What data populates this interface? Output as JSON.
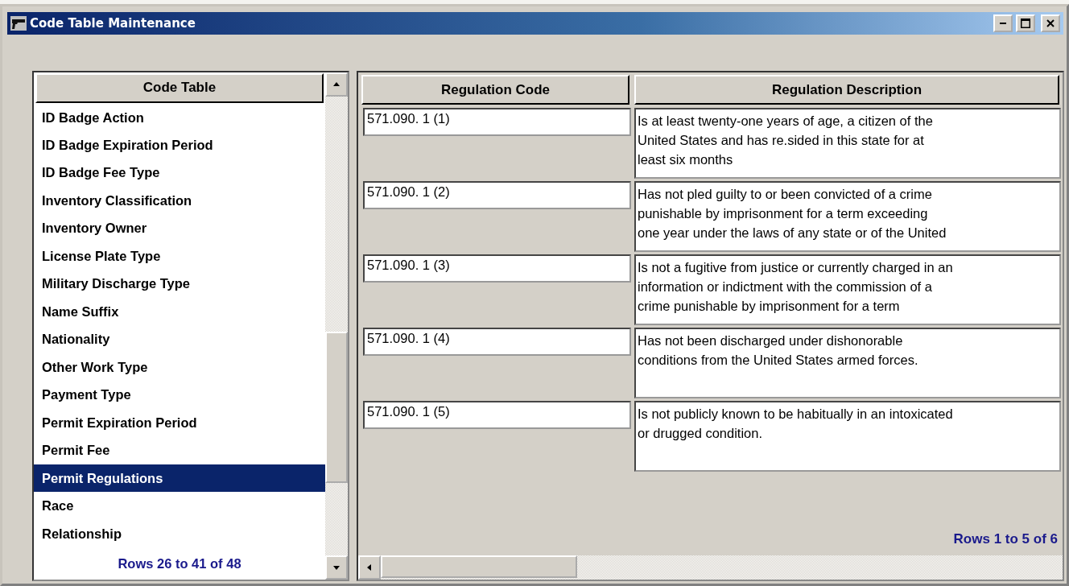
{
  "window": {
    "title": "Code Table Maintenance"
  },
  "code_table": {
    "header": "Code Table",
    "items": [
      {
        "label": "ID Badge Action",
        "selected": false
      },
      {
        "label": "ID Badge Expiration Period",
        "selected": false
      },
      {
        "label": "ID Badge Fee Type",
        "selected": false
      },
      {
        "label": "Inventory Classification",
        "selected": false
      },
      {
        "label": "Inventory Owner",
        "selected": false
      },
      {
        "label": "License Plate Type",
        "selected": false
      },
      {
        "label": "Military Discharge Type",
        "selected": false
      },
      {
        "label": "Name Suffix",
        "selected": false
      },
      {
        "label": "Nationality",
        "selected": false
      },
      {
        "label": "Other Work Type",
        "selected": false
      },
      {
        "label": "Payment Type",
        "selected": false
      },
      {
        "label": "Permit Expiration Period",
        "selected": false
      },
      {
        "label": "Permit Fee",
        "selected": false
      },
      {
        "label": "Permit Regulations",
        "selected": true
      },
      {
        "label": "Race",
        "selected": false
      },
      {
        "label": "Relationship",
        "selected": false
      }
    ],
    "row_count": "Rows 26 to 41 of 48"
  },
  "regulations": {
    "columns": [
      "Regulation Code",
      "Regulation Description"
    ],
    "rows": [
      {
        "code": "571.090. 1 (1)",
        "description": [
          "Is at least twenty-one years of age, a citizen of the",
          "United States and has re.sided in this state for at",
          "least six months"
        ]
      },
      {
        "code": "571.090. 1 (2)",
        "description": [
          "Has not pled guilty to or been convicted of a crime",
          "punishable by imprisonment for a term exceeding",
          "one year under the laws of any state or of the United"
        ]
      },
      {
        "code": "571.090. 1 (3)",
        "description": [
          "Is not a fugitive from justice or currently charged in an",
          "information or indictment with the commission of a",
          "crime punishable by imprisonment for a term"
        ]
      },
      {
        "code": "571.090. 1 (4)",
        "description": [
          "Has not been discharged under dishonorable",
          "conditions from the United States armed forces."
        ]
      },
      {
        "code": "571.090. 1 (5)",
        "description": [
          "Is not publicly known to be habitually in an intoxicated",
          "or drugged condition."
        ]
      }
    ],
    "row_count": "Rows 1 to 5 of 6"
  }
}
